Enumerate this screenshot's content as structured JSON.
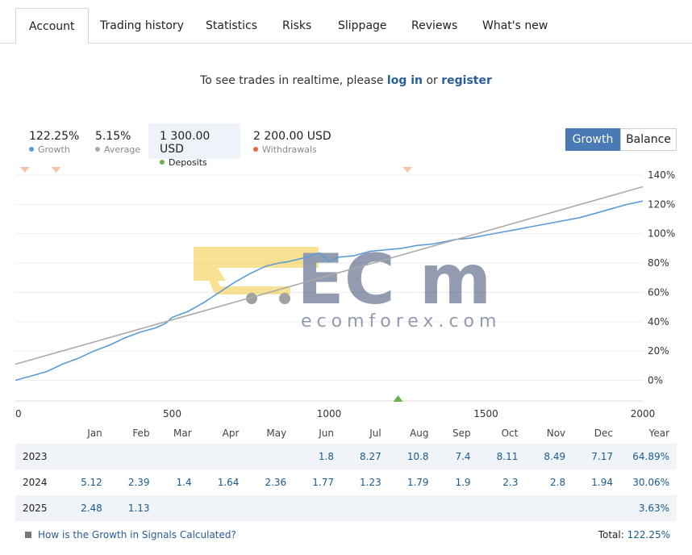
{
  "tabs": [
    "Account",
    "Trading history",
    "Statistics",
    "Risks",
    "Slippage",
    "Reviews",
    "What's new"
  ],
  "realtime": {
    "prefix": "To see trades in realtime, please ",
    "login": "log in",
    "middle": " or ",
    "register": "register"
  },
  "stats": [
    {
      "value": "122.25%",
      "label": "Growth",
      "color": "#5b9bd5"
    },
    {
      "value": "5.15%",
      "label": "Average",
      "color": "#aaaaaa"
    },
    {
      "value": "1 300.00 USD",
      "label": "Deposits",
      "color": "#6ab04c"
    },
    {
      "value": "2 200.00 USD",
      "label": "Withdrawals",
      "color": "#e06a4a"
    }
  ],
  "toggle": {
    "growth": "Growth",
    "balance": "Balance"
  },
  "watermark": {
    "logo_letters": "EC m",
    "site": "ecomforex.com"
  },
  "chart_data": {
    "type": "line",
    "x_ticks": [
      "0",
      "500",
      "1000",
      "1500",
      "2000"
    ],
    "y_ticks": [
      "0%",
      "20%",
      "40%",
      "60%",
      "80%",
      "100%",
      "120%",
      "140%"
    ],
    "xlim": [
      0,
      2000
    ],
    "ylim": [
      -14,
      140
    ],
    "grid": true,
    "series": [
      {
        "color": "#5b9bd5",
        "points": [
          [
            0,
            0
          ],
          [
            50,
            3
          ],
          [
            100,
            6
          ],
          [
            150,
            11
          ],
          [
            200,
            15
          ],
          [
            250,
            20
          ],
          [
            300,
            24
          ],
          [
            350,
            29
          ],
          [
            400,
            33
          ],
          [
            450,
            36
          ],
          [
            480,
            39
          ],
          [
            500,
            43
          ],
          [
            550,
            47
          ],
          [
            600,
            53
          ],
          [
            650,
            60
          ],
          [
            700,
            67
          ],
          [
            750,
            73
          ],
          [
            800,
            78
          ],
          [
            840,
            80
          ],
          [
            870,
            81
          ],
          [
            930,
            84
          ],
          [
            970,
            87
          ],
          [
            1000,
            81
          ],
          [
            1030,
            84
          ],
          [
            1080,
            85
          ],
          [
            1130,
            88
          ],
          [
            1180,
            89
          ],
          [
            1230,
            90
          ],
          [
            1280,
            92
          ],
          [
            1330,
            93
          ],
          [
            1380,
            95
          ],
          [
            1400,
            96
          ],
          [
            1450,
            97
          ],
          [
            1500,
            99
          ],
          [
            1550,
            101
          ],
          [
            1600,
            103
          ],
          [
            1650,
            105
          ],
          [
            1700,
            107
          ],
          [
            1750,
            109
          ],
          [
            1800,
            111
          ],
          [
            1850,
            114
          ],
          [
            1900,
            117
          ],
          [
            1950,
            120
          ],
          [
            2000,
            122.25
          ]
        ]
      },
      {
        "color": "#aaaaaa",
        "points": [
          [
            0,
            11
          ],
          [
            2000,
            132
          ]
        ]
      }
    ],
    "markers": {
      "withdrawals_x": [
        30,
        130,
        1250
      ],
      "deposits_x": [
        1220
      ]
    }
  },
  "months": [
    "Jan",
    "Feb",
    "Mar",
    "Apr",
    "May",
    "Jun",
    "Jul",
    "Aug",
    "Sep",
    "Oct",
    "Nov",
    "Dec",
    "Year"
  ],
  "rows": [
    {
      "year": "2023",
      "vals": [
        "",
        "",
        "",
        "",
        "",
        "1.8",
        "8.27",
        "10.8",
        "7.4",
        "8.11",
        "8.49",
        "7.17",
        "64.89%"
      ]
    },
    {
      "year": "2024",
      "vals": [
        "5.12",
        "2.39",
        "1.4",
        "1.64",
        "2.36",
        "1.77",
        "1.23",
        "1.79",
        "1.9",
        "2.3",
        "2.8",
        "1.94",
        "30.06%"
      ]
    },
    {
      "year": "2025",
      "vals": [
        "2.48",
        "1.13",
        "",
        "",
        "",
        "",
        "",
        "",
        "",
        "",
        "",
        "",
        "3.63%"
      ]
    }
  ],
  "footer": {
    "how": "How is the Growth in Signals Calculated?",
    "total_label": "Total: ",
    "total_value": "122.25%"
  }
}
